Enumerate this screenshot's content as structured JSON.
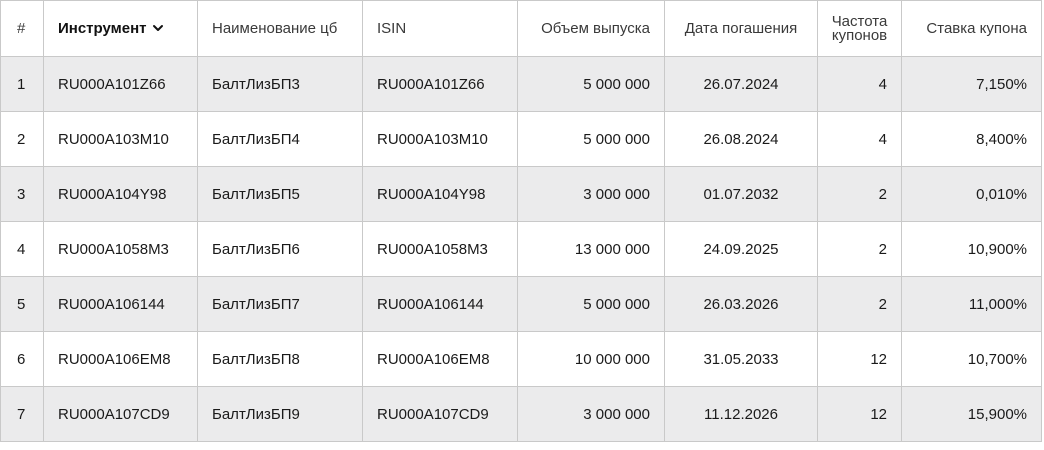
{
  "table": {
    "columns": {
      "index": "#",
      "instrument": "Инструмент",
      "name": "Наименование цб",
      "isin": "ISIN",
      "volume": "Объем выпуска",
      "maturity": "Дата погашения",
      "frequency_line1": "Частота",
      "frequency_line2": "купонов",
      "rate": "Ставка купона"
    },
    "sort_icon": "chevron-down-icon",
    "rows": [
      {
        "index": "1",
        "instrument": "RU000A101Z66",
        "name": "БалтЛизБП3",
        "isin": "RU000A101Z66",
        "volume": "5 000 000",
        "maturity": "26.07.2024",
        "frequency": "4",
        "rate": "7,150%"
      },
      {
        "index": "2",
        "instrument": "RU000A103M10",
        "name": "БалтЛизБП4",
        "isin": "RU000A103M10",
        "volume": "5 000 000",
        "maturity": "26.08.2024",
        "frequency": "4",
        "rate": "8,400%"
      },
      {
        "index": "3",
        "instrument": "RU000A104Y98",
        "name": "БалтЛизБП5",
        "isin": "RU000A104Y98",
        "volume": "3 000 000",
        "maturity": "01.07.2032",
        "frequency": "2",
        "rate": "0,010%"
      },
      {
        "index": "4",
        "instrument": "RU000A1058M3",
        "name": "БалтЛизБП6",
        "isin": "RU000A1058M3",
        "volume": "13 000 000",
        "maturity": "24.09.2025",
        "frequency": "2",
        "rate": "10,900%"
      },
      {
        "index": "5",
        "instrument": "RU000A106144",
        "name": "БалтЛизБП7",
        "isin": "RU000A106144",
        "volume": "5 000 000",
        "maturity": "26.03.2026",
        "frequency": "2",
        "rate": "11,000%"
      },
      {
        "index": "6",
        "instrument": "RU000A106EM8",
        "name": "БалтЛизБП8",
        "isin": "RU000A106EM8",
        "volume": "10 000 000",
        "maturity": "31.05.2033",
        "frequency": "12",
        "rate": "10,700%"
      },
      {
        "index": "7",
        "instrument": "RU000A107CD9",
        "name": "БалтЛизБП9",
        "isin": "RU000A107CD9",
        "volume": "3 000 000",
        "maturity": "11.12.2026",
        "frequency": "12",
        "rate": "15,900%"
      }
    ]
  }
}
